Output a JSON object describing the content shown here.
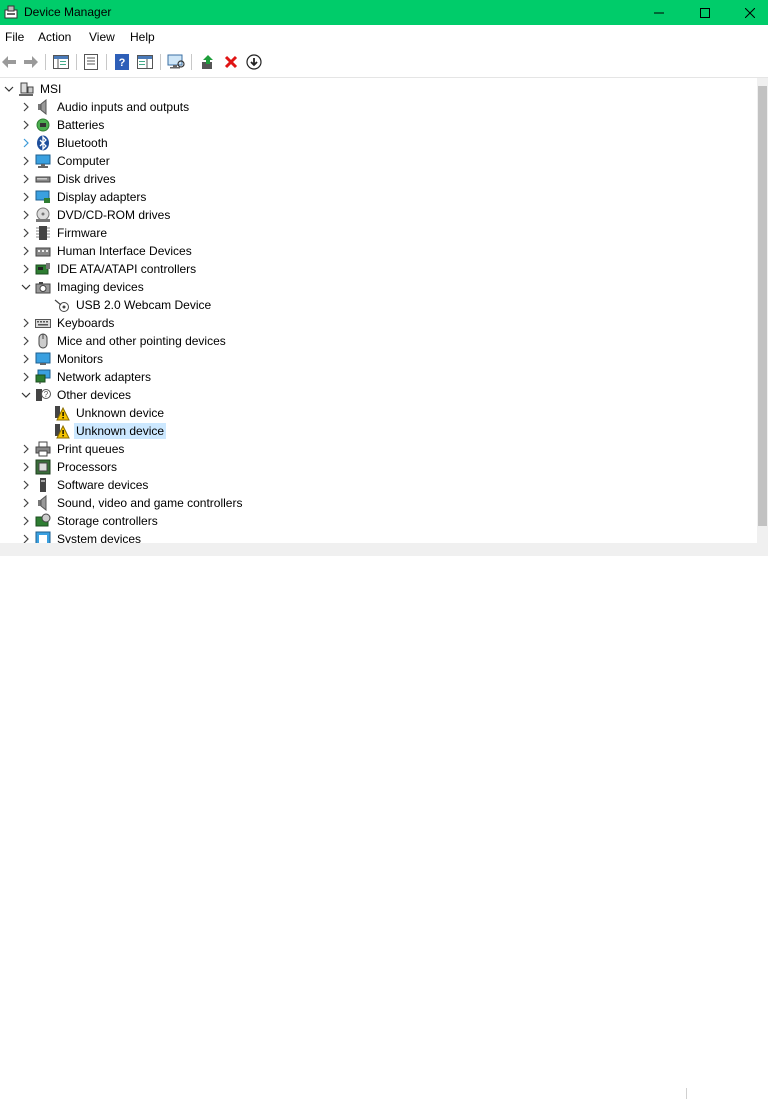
{
  "window": {
    "title": "Device Manager",
    "icon": "device-manager-icon",
    "title_bar_color": "#00cc6a"
  },
  "menu": {
    "file": "File",
    "action": "Action",
    "view": "View",
    "help": "Help"
  },
  "toolbar": {
    "icons": [
      "back-arrow-icon",
      "forward-arrow-icon",
      "show-hide-console-tree-icon",
      "properties-icon",
      "help-icon",
      "action-pane-icon",
      "scan-hardware-icon",
      "update-driver-icon",
      "uninstall-device-icon",
      "disable-device-icon"
    ]
  },
  "tree": {
    "root": "MSI",
    "items": [
      {
        "label": "Audio inputs and outputs",
        "icon": "speaker-icon",
        "expanded": false
      },
      {
        "label": "Batteries",
        "icon": "battery-icon",
        "expanded": false
      },
      {
        "label": "Bluetooth",
        "icon": "bluetooth-icon",
        "expanded": false
      },
      {
        "label": "Computer",
        "icon": "computer-icon",
        "expanded": false
      },
      {
        "label": "Disk drives",
        "icon": "disk-drive-icon",
        "expanded": false
      },
      {
        "label": "Display adapters",
        "icon": "display-adapter-icon",
        "expanded": false
      },
      {
        "label": "DVD/CD-ROM drives",
        "icon": "dvd-drive-icon",
        "expanded": false
      },
      {
        "label": "Firmware",
        "icon": "firmware-icon",
        "expanded": false
      },
      {
        "label": "Human Interface Devices",
        "icon": "hid-icon",
        "expanded": false
      },
      {
        "label": "IDE ATA/ATAPI controllers",
        "icon": "ide-controller-icon",
        "expanded": false
      },
      {
        "label": "Imaging devices",
        "icon": "camera-icon",
        "expanded": true,
        "children": [
          {
            "label": "USB 2.0 Webcam Device",
            "icon": "webcam-icon"
          }
        ]
      },
      {
        "label": "Keyboards",
        "icon": "keyboard-icon",
        "expanded": false
      },
      {
        "label": "Mice and other pointing devices",
        "icon": "mouse-icon",
        "expanded": false
      },
      {
        "label": "Monitors",
        "icon": "monitor-icon",
        "expanded": false
      },
      {
        "label": "Network adapters",
        "icon": "network-adapter-icon",
        "expanded": false
      },
      {
        "label": "Other devices",
        "icon": "unknown-device-category-icon",
        "expanded": true,
        "children": [
          {
            "label": "Unknown device",
            "icon": "warning-device-icon",
            "selected": false
          },
          {
            "label": "Unknown device",
            "icon": "warning-device-icon",
            "selected": true
          }
        ]
      },
      {
        "label": "Print queues",
        "icon": "printer-icon",
        "expanded": false
      },
      {
        "label": "Processors",
        "icon": "processor-icon",
        "expanded": false
      },
      {
        "label": "Software devices",
        "icon": "software-device-icon",
        "expanded": false
      },
      {
        "label": "Sound, video and game controllers",
        "icon": "sound-controller-icon",
        "expanded": false
      },
      {
        "label": "Storage controllers",
        "icon": "storage-controller-icon",
        "expanded": false
      },
      {
        "label": "System devices",
        "icon": "system-devices-icon",
        "expanded": false
      }
    ]
  }
}
